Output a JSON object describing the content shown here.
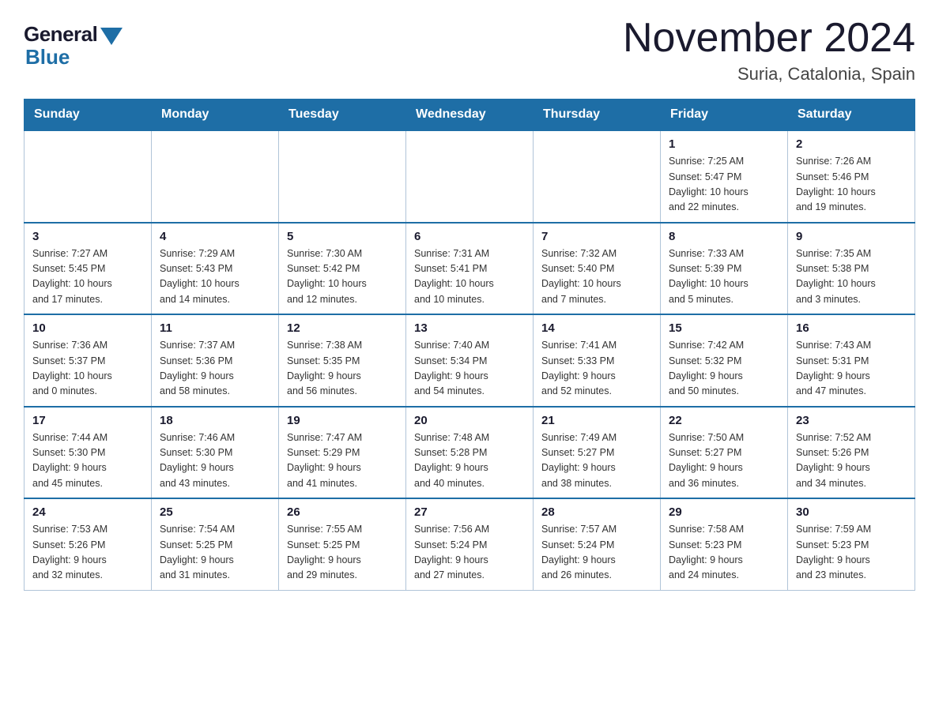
{
  "logo": {
    "general": "General",
    "blue": "Blue"
  },
  "title": {
    "month_year": "November 2024",
    "location": "Suria, Catalonia, Spain"
  },
  "days_of_week": [
    "Sunday",
    "Monday",
    "Tuesday",
    "Wednesday",
    "Thursday",
    "Friday",
    "Saturday"
  ],
  "weeks": [
    [
      {
        "day": "",
        "info": ""
      },
      {
        "day": "",
        "info": ""
      },
      {
        "day": "",
        "info": ""
      },
      {
        "day": "",
        "info": ""
      },
      {
        "day": "",
        "info": ""
      },
      {
        "day": "1",
        "info": "Sunrise: 7:25 AM\nSunset: 5:47 PM\nDaylight: 10 hours\nand 22 minutes."
      },
      {
        "day": "2",
        "info": "Sunrise: 7:26 AM\nSunset: 5:46 PM\nDaylight: 10 hours\nand 19 minutes."
      }
    ],
    [
      {
        "day": "3",
        "info": "Sunrise: 7:27 AM\nSunset: 5:45 PM\nDaylight: 10 hours\nand 17 minutes."
      },
      {
        "day": "4",
        "info": "Sunrise: 7:29 AM\nSunset: 5:43 PM\nDaylight: 10 hours\nand 14 minutes."
      },
      {
        "day": "5",
        "info": "Sunrise: 7:30 AM\nSunset: 5:42 PM\nDaylight: 10 hours\nand 12 minutes."
      },
      {
        "day": "6",
        "info": "Sunrise: 7:31 AM\nSunset: 5:41 PM\nDaylight: 10 hours\nand 10 minutes."
      },
      {
        "day": "7",
        "info": "Sunrise: 7:32 AM\nSunset: 5:40 PM\nDaylight: 10 hours\nand 7 minutes."
      },
      {
        "day": "8",
        "info": "Sunrise: 7:33 AM\nSunset: 5:39 PM\nDaylight: 10 hours\nand 5 minutes."
      },
      {
        "day": "9",
        "info": "Sunrise: 7:35 AM\nSunset: 5:38 PM\nDaylight: 10 hours\nand 3 minutes."
      }
    ],
    [
      {
        "day": "10",
        "info": "Sunrise: 7:36 AM\nSunset: 5:37 PM\nDaylight: 10 hours\nand 0 minutes."
      },
      {
        "day": "11",
        "info": "Sunrise: 7:37 AM\nSunset: 5:36 PM\nDaylight: 9 hours\nand 58 minutes."
      },
      {
        "day": "12",
        "info": "Sunrise: 7:38 AM\nSunset: 5:35 PM\nDaylight: 9 hours\nand 56 minutes."
      },
      {
        "day": "13",
        "info": "Sunrise: 7:40 AM\nSunset: 5:34 PM\nDaylight: 9 hours\nand 54 minutes."
      },
      {
        "day": "14",
        "info": "Sunrise: 7:41 AM\nSunset: 5:33 PM\nDaylight: 9 hours\nand 52 minutes."
      },
      {
        "day": "15",
        "info": "Sunrise: 7:42 AM\nSunset: 5:32 PM\nDaylight: 9 hours\nand 50 minutes."
      },
      {
        "day": "16",
        "info": "Sunrise: 7:43 AM\nSunset: 5:31 PM\nDaylight: 9 hours\nand 47 minutes."
      }
    ],
    [
      {
        "day": "17",
        "info": "Sunrise: 7:44 AM\nSunset: 5:30 PM\nDaylight: 9 hours\nand 45 minutes."
      },
      {
        "day": "18",
        "info": "Sunrise: 7:46 AM\nSunset: 5:30 PM\nDaylight: 9 hours\nand 43 minutes."
      },
      {
        "day": "19",
        "info": "Sunrise: 7:47 AM\nSunset: 5:29 PM\nDaylight: 9 hours\nand 41 minutes."
      },
      {
        "day": "20",
        "info": "Sunrise: 7:48 AM\nSunset: 5:28 PM\nDaylight: 9 hours\nand 40 minutes."
      },
      {
        "day": "21",
        "info": "Sunrise: 7:49 AM\nSunset: 5:27 PM\nDaylight: 9 hours\nand 38 minutes."
      },
      {
        "day": "22",
        "info": "Sunrise: 7:50 AM\nSunset: 5:27 PM\nDaylight: 9 hours\nand 36 minutes."
      },
      {
        "day": "23",
        "info": "Sunrise: 7:52 AM\nSunset: 5:26 PM\nDaylight: 9 hours\nand 34 minutes."
      }
    ],
    [
      {
        "day": "24",
        "info": "Sunrise: 7:53 AM\nSunset: 5:26 PM\nDaylight: 9 hours\nand 32 minutes."
      },
      {
        "day": "25",
        "info": "Sunrise: 7:54 AM\nSunset: 5:25 PM\nDaylight: 9 hours\nand 31 minutes."
      },
      {
        "day": "26",
        "info": "Sunrise: 7:55 AM\nSunset: 5:25 PM\nDaylight: 9 hours\nand 29 minutes."
      },
      {
        "day": "27",
        "info": "Sunrise: 7:56 AM\nSunset: 5:24 PM\nDaylight: 9 hours\nand 27 minutes."
      },
      {
        "day": "28",
        "info": "Sunrise: 7:57 AM\nSunset: 5:24 PM\nDaylight: 9 hours\nand 26 minutes."
      },
      {
        "day": "29",
        "info": "Sunrise: 7:58 AM\nSunset: 5:23 PM\nDaylight: 9 hours\nand 24 minutes."
      },
      {
        "day": "30",
        "info": "Sunrise: 7:59 AM\nSunset: 5:23 PM\nDaylight: 9 hours\nand 23 minutes."
      }
    ]
  ]
}
